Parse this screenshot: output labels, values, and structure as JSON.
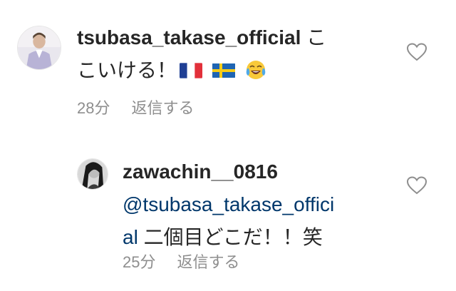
{
  "comments": [
    {
      "username": "tsubasa_takase_official",
      "text_line1": " こ",
      "text_line2": "こいける！",
      "emojis": [
        "flag-france-icon",
        "flag-sweden-icon",
        "tears-of-joy-emoji-icon"
      ],
      "time": "28分",
      "reply_label": "返信する"
    },
    {
      "username": "zawachin__0816",
      "mention_line1": "@tsubasa_takase_offici",
      "mention_line2": "al",
      "text": " 二個目どこだ！！笑",
      "time": "25分",
      "reply_label": "返信する"
    }
  ],
  "colors": {
    "text": "#262626",
    "meta": "#8e8e8e",
    "mention": "#00376b",
    "heart": "#8e8e8e"
  }
}
